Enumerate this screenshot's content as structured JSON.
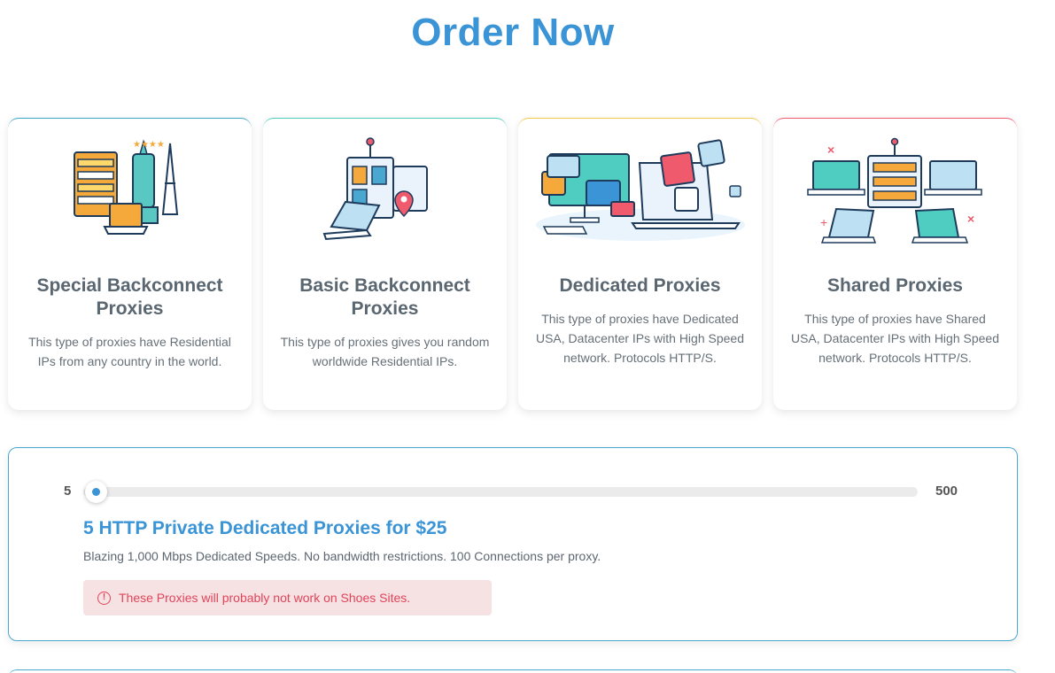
{
  "page": {
    "title": "Order Now"
  },
  "cards": [
    {
      "title": "Special Backconnect Proxies",
      "description": "This type of proxies have Residential IPs from any country in the world."
    },
    {
      "title": "Basic Backconnect Proxies",
      "description": "This type of proxies gives you random worldwide Residential IPs."
    },
    {
      "title": "Dedicated Proxies",
      "description": "This type of proxies have Dedicated USA, Datacenter IPs with High Speed network. Protocols HTTP/S."
    },
    {
      "title": "Shared Proxies",
      "description": "This type of proxies have Shared USA, Datacenter IPs with High Speed network. Protocols HTTP/S."
    }
  ],
  "order": {
    "slider": {
      "min": "5",
      "max": "500",
      "value": 5
    },
    "offer_title": "5 HTTP Private Dedicated Proxies for $25",
    "offer_description": "Blazing 1,000 Mbps Dedicated Speeds. No bandwidth restrictions. 100 Connections per proxy.",
    "warning": "These Proxies will probably not work on Shoes Sites.",
    "warning_icon": "alert-circle-icon"
  },
  "colors": {
    "accent": "#3a94d6",
    "warning_bg": "#f6e1e3",
    "warning_text": "#e0455a"
  }
}
